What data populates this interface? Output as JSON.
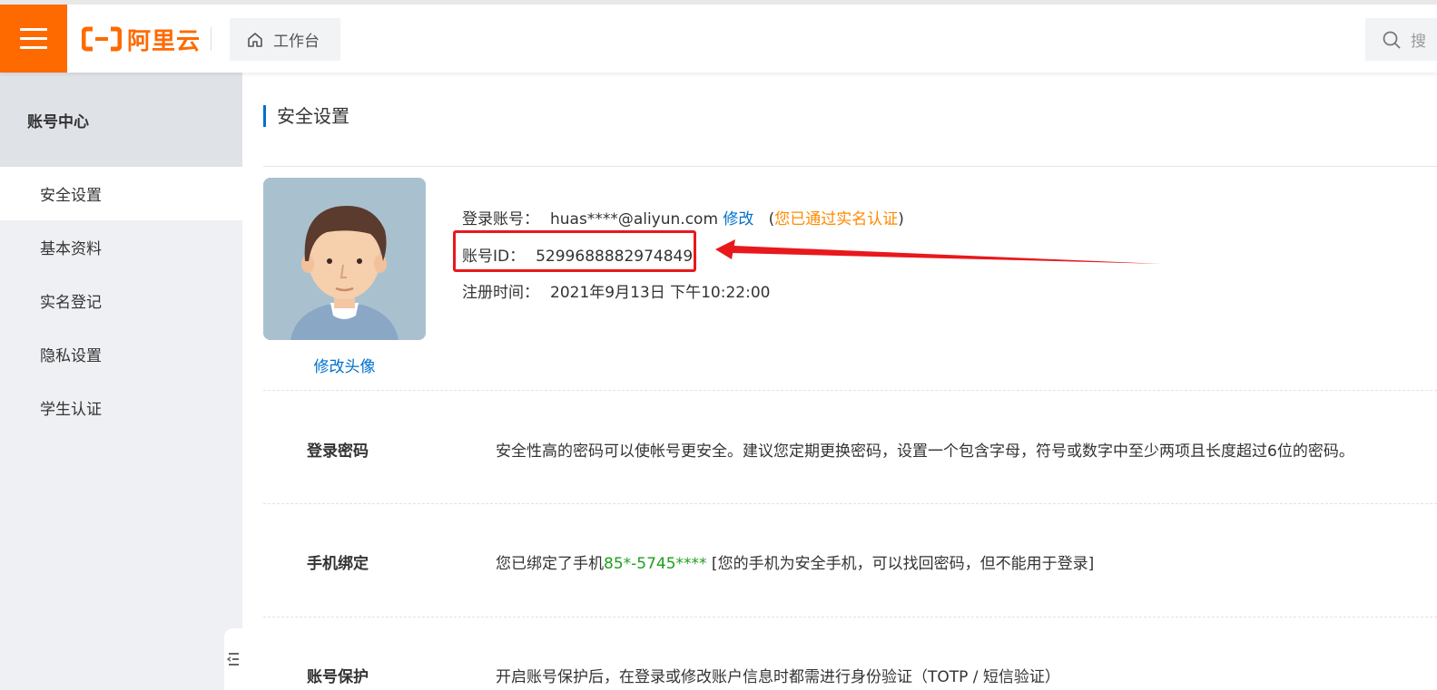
{
  "header": {
    "logo_text": "阿里云",
    "workbench_label": "工作台",
    "search_placeholder": "搜"
  },
  "sidebar": {
    "title": "账号中心",
    "items": [
      {
        "label": "安全设置",
        "active": true
      },
      {
        "label": "基本资料"
      },
      {
        "label": "实名登记"
      },
      {
        "label": "隐私设置"
      },
      {
        "label": "学生认证"
      }
    ]
  },
  "main": {
    "title": "安全设置",
    "avatar_link": "修改头像",
    "account": {
      "login_label": "登录账号：",
      "login_value": "huas****@aliyun.com",
      "modify_link": "修改",
      "verify_open": "(",
      "verify_text": "您已通过实名认证",
      "verify_close": ")",
      "id_label": "账号ID：",
      "id_value": "5299688882974849",
      "reg_label": "注册时间：",
      "reg_value": "2021年9月13日 下午10:22:00"
    },
    "rows": {
      "password_label": "登录密码",
      "password_desc": "安全性高的密码可以使帐号更安全。建议您定期更换密码，设置一个包含字母，符号或数字中至少两项且长度超过6位的密码。",
      "phone_label": "手机绑定",
      "phone_prefix": "您已绑定了手机",
      "phone_number": "85*-5745****",
      "phone_suffix": " [您的手机为安全手机，可以找回密码，但不能用于登录]",
      "protect_label": "账号保护",
      "protect_desc": "开启账号保护后，在登录或修改账户信息时都需进行身份验证（TOTP / 短信验证）"
    }
  },
  "colors": {
    "brand": "#ff6a00",
    "link": "#0070cc",
    "highlight": "#e8181c",
    "verified": "#ff8a00",
    "phone": "#1e9e1e"
  }
}
